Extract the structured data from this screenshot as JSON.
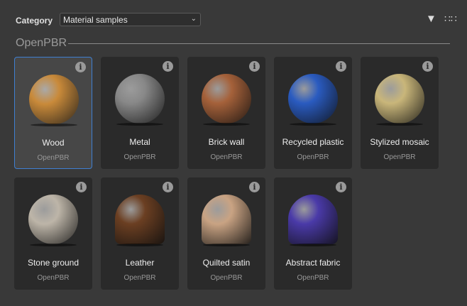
{
  "toolbar": {
    "category_label": "Category",
    "category_value": "Material samples",
    "filter_icon": "filter-icon",
    "view_icon": "grid-view-icon"
  },
  "section": {
    "title": "OpenPBR"
  },
  "materials": [
    {
      "name": "Wood",
      "type": "OpenPBR",
      "color": "#c98a3a",
      "selected": true
    },
    {
      "name": "Metal",
      "type": "OpenPBR",
      "color": "#888888"
    },
    {
      "name": "Brick wall",
      "type": "OpenPBR",
      "color": "#a5613a"
    },
    {
      "name": "Recycled plastic",
      "type": "OpenPBR",
      "color": "#2a5bc0"
    },
    {
      "name": "Stylized mosaic",
      "type": "OpenPBR",
      "color": "#c9b67a"
    },
    {
      "name": "Stone ground",
      "type": "OpenPBR",
      "color": "#bdb5a8"
    },
    {
      "name": "Leather",
      "type": "OpenPBR",
      "color": "#6b3f22"
    },
    {
      "name": "Quilted satin",
      "type": "OpenPBR",
      "color": "#c9a383"
    },
    {
      "name": "Abstract fabric",
      "type": "OpenPBR",
      "color": "#4a3aa8"
    }
  ],
  "info_glyph": "i"
}
